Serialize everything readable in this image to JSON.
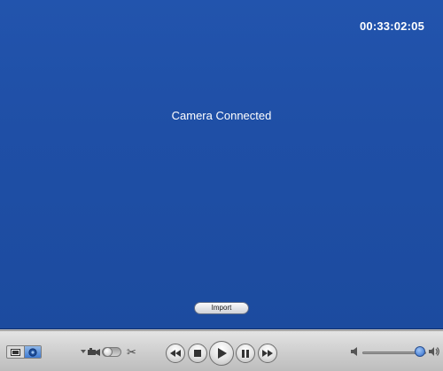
{
  "viewer": {
    "timecode": "00:33:02:05",
    "status": "Camera Connected",
    "import_label": "Import"
  },
  "toolbar": {
    "mode_buttons": [
      "clip-view-icon",
      "event-view-icon"
    ],
    "camera_switch": {
      "left_icon": "camera-icon",
      "right_icon": "scissors-icon",
      "glyph_scissors": "✂"
    },
    "transport": [
      "rewind-icon",
      "stop-icon",
      "play-icon",
      "pause-icon",
      "fast-forward-icon"
    ],
    "volume": {
      "level": 0.9,
      "low_icon": "volume-low-icon",
      "high_icon": "volume-high-icon"
    }
  },
  "colors": {
    "viewer_bg": "#1f4fa6",
    "accent": "#2e6ccc"
  }
}
